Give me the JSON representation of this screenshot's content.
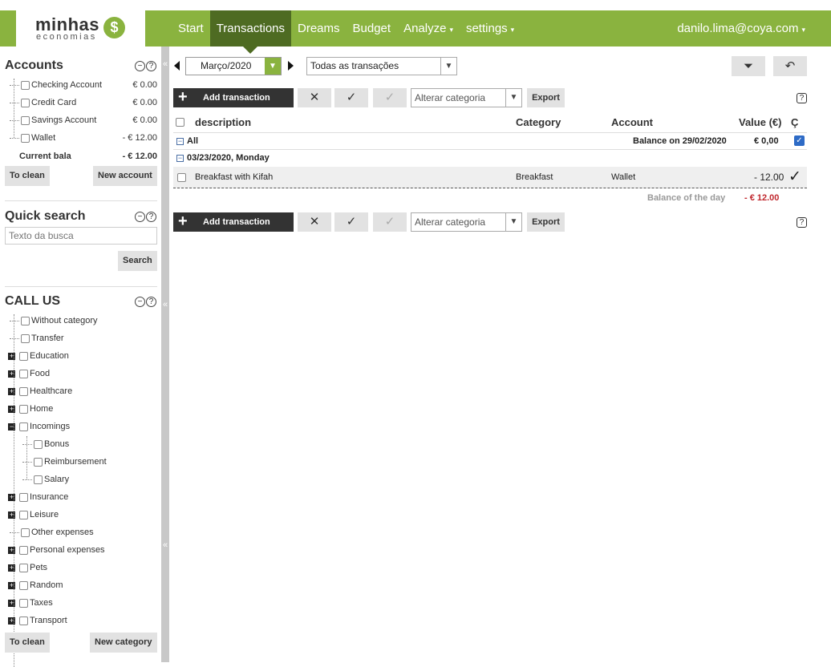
{
  "header": {
    "logo_word1": "minhas",
    "logo_word2": "economias",
    "logo_symbol": "$",
    "nav": [
      {
        "label": "Start"
      },
      {
        "label": "Transactions"
      },
      {
        "label": "Dreams"
      },
      {
        "label": "Budget"
      },
      {
        "label": "Analyze"
      },
      {
        "label": "settings"
      }
    ],
    "user_email": "danilo.lima@coya.com"
  },
  "accounts": {
    "title": "Accounts",
    "items": [
      {
        "label": "Checking Account",
        "amount": "€ 0.00"
      },
      {
        "label": "Credit Card",
        "amount": "€ 0.00"
      },
      {
        "label": "Savings Account",
        "amount": "€ 0.00"
      },
      {
        "label": "Wallet",
        "amount": "- € 12.00"
      }
    ],
    "current_label": "Current bala",
    "current_amount": "- € 12.00",
    "clean_label": "To clean",
    "new_label": "New account"
  },
  "quick_search": {
    "title": "Quick search",
    "placeholder": "Texto da busca",
    "button": "Search"
  },
  "categories": {
    "title": "CALL US",
    "items": [
      {
        "label": "Without category",
        "expand": ""
      },
      {
        "label": "Transfer",
        "expand": ""
      },
      {
        "label": "Education",
        "expand": "+"
      },
      {
        "label": "Food",
        "expand": "+"
      },
      {
        "label": "Healthcare",
        "expand": "+"
      },
      {
        "label": "Home",
        "expand": "+"
      },
      {
        "label": "Incomings",
        "expand": "-"
      },
      {
        "label": "Bonus",
        "expand": ""
      },
      {
        "label": "Reimbursement",
        "expand": ""
      },
      {
        "label": "Salary",
        "expand": ""
      },
      {
        "label": "Insurance",
        "expand": "+"
      },
      {
        "label": "Leisure",
        "expand": "+"
      },
      {
        "label": "Other expenses",
        "expand": ""
      },
      {
        "label": "Personal expenses",
        "expand": "+"
      },
      {
        "label": "Pets",
        "expand": "+"
      },
      {
        "label": "Random",
        "expand": "+"
      },
      {
        "label": "Taxes",
        "expand": "+"
      },
      {
        "label": "Transport",
        "expand": "+"
      }
    ],
    "clean_label": "To clean",
    "new_label": "New category"
  },
  "filters": {
    "month": "Março/2020",
    "transaction_filter": "Todas as transações"
  },
  "toolbar": {
    "add_label": "Add transaction",
    "category_placeholder": "Alterar categoria",
    "export_label": "Export",
    "help": "?"
  },
  "table": {
    "headers": {
      "description": "description",
      "category": "Category",
      "account": "Account",
      "value": "Value (€)",
      "c": "Ç"
    },
    "all_label": "All",
    "balance_label": "Balance on 29/02/2020",
    "balance_value": "€ 0,00",
    "date_group": "03/23/2020, Monday",
    "rows": [
      {
        "description": "Breakfast with Kifah",
        "category": "Breakfast",
        "account": "Wallet",
        "value": "- 12.00"
      }
    ],
    "day_balance_label": "Balance of the day",
    "day_balance_value": "- € 12.00"
  },
  "colors": {
    "brand_green": "#8ab33f",
    "nav_active": "#4e6b22",
    "negative": "#c0272d"
  }
}
